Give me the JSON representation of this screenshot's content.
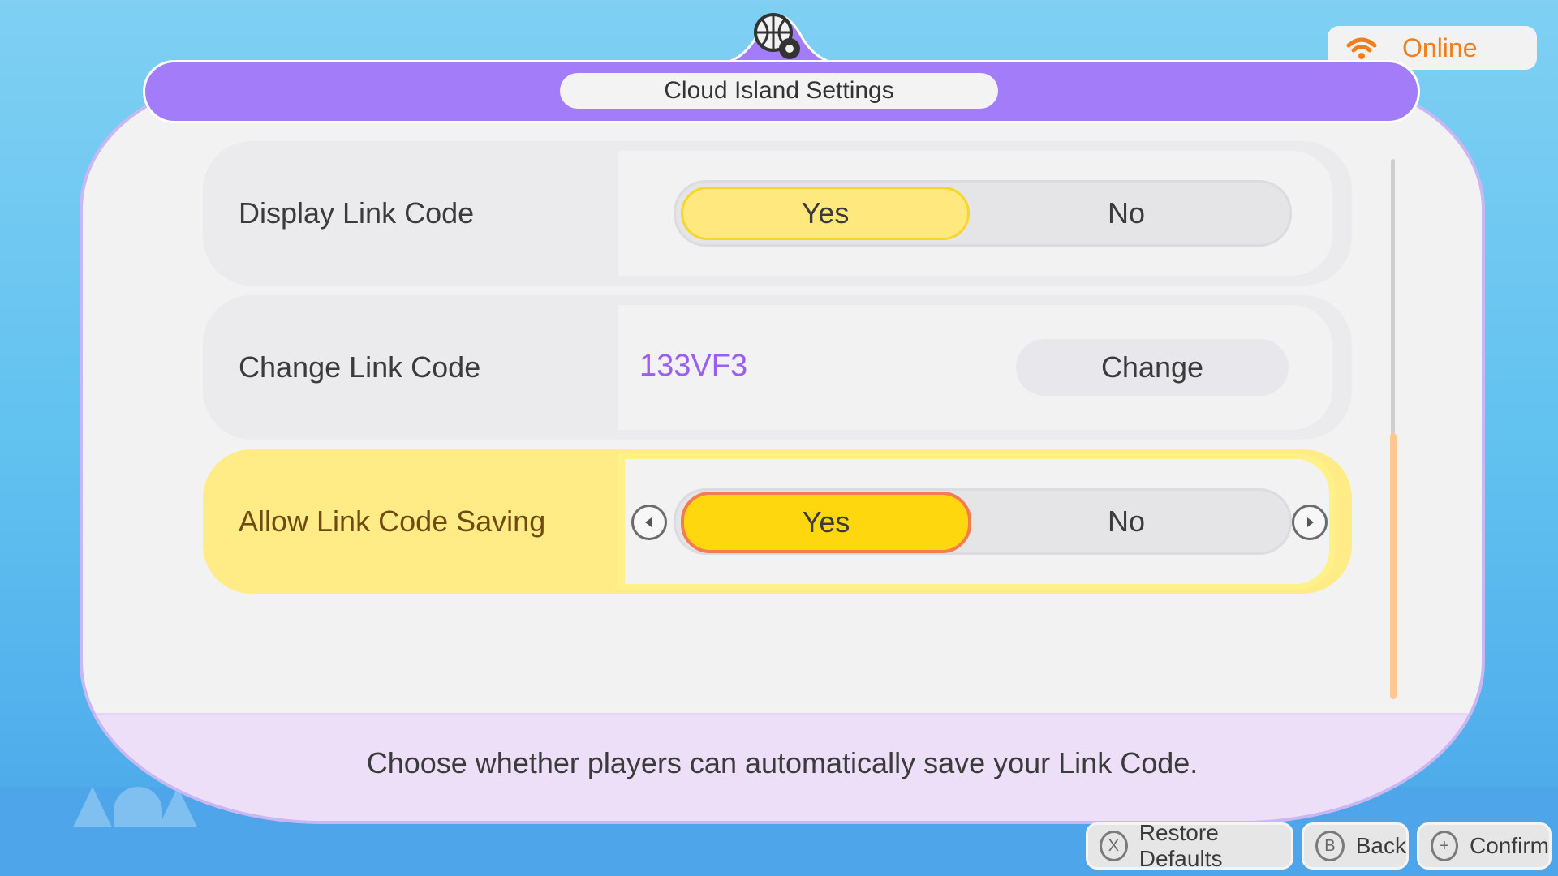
{
  "status": {
    "connection_label": "Online",
    "colors": {
      "accent": "#f07e1c"
    }
  },
  "header": {
    "title": "Cloud Island Settings",
    "icon": "globe-gear-icon"
  },
  "rows": [
    {
      "label": "Display Link Code",
      "options": [
        "Yes",
        "No"
      ],
      "selected": "Yes"
    },
    {
      "label": "Change Link Code",
      "value": "133VF3",
      "button_label": "Change"
    },
    {
      "label": "Allow Link Code Saving",
      "options": [
        "Yes",
        "No"
      ],
      "selected": "Yes"
    }
  ],
  "hint": "Choose whether players can automatically save your Link Code.",
  "controls": [
    {
      "button": "X",
      "label": "Restore Defaults"
    },
    {
      "button": "B",
      "label": "Back"
    },
    {
      "button": "+",
      "label": "Confirm"
    }
  ],
  "colors": {
    "purple": "#a37df9",
    "yellow": "#ffd70f",
    "code": "#9b5ef0"
  }
}
